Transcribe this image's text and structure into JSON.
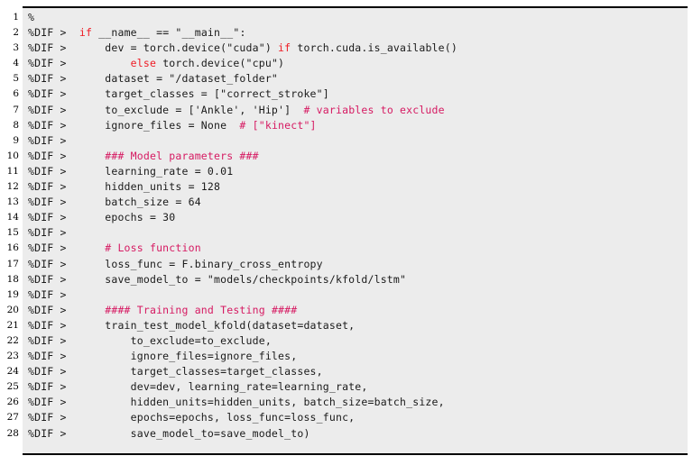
{
  "listing": {
    "kind": "latexdiff-code-listing",
    "background_color": "#ececec",
    "page_background": "#ffffff",
    "rule_color": "#000000",
    "text_color": "#1a1a1a",
    "keyword_color": "#ee1c25",
    "comment_color": "#d61a62",
    "line_number_color": "#000000",
    "first_line_number": 1,
    "last_line_number": 28,
    "total_lines": 28,
    "diff_marker": "%DIF >",
    "line_numbers": [
      "1",
      "2",
      "3",
      "4",
      "5",
      "6",
      "7",
      "8",
      "9",
      "10",
      "11",
      "12",
      "13",
      "14",
      "15",
      "16",
      "17",
      "18",
      "19",
      "20",
      "21",
      "22",
      "23",
      "24",
      "25",
      "26",
      "27",
      "28"
    ],
    "lines": [
      {
        "number": "1",
        "tokens": [
          {
            "t": "%",
            "c": "pln"
          }
        ]
      },
      {
        "number": "2",
        "tokens": [
          {
            "t": "%DIF >  ",
            "c": "pln"
          },
          {
            "t": "if",
            "c": "kw"
          },
          {
            "t": " __name__ == \"__main__\":",
            "c": "pln"
          }
        ]
      },
      {
        "number": "3",
        "tokens": [
          {
            "t": "%DIF >      dev = torch.device(\"cuda\") ",
            "c": "pln"
          },
          {
            "t": "if",
            "c": "kw"
          },
          {
            "t": " torch.cuda.is_available()",
            "c": "pln"
          }
        ]
      },
      {
        "number": "4",
        "tokens": [
          {
            "t": "%DIF >          ",
            "c": "pln"
          },
          {
            "t": "else",
            "c": "kw"
          },
          {
            "t": " torch.device(\"cpu\")",
            "c": "pln"
          }
        ]
      },
      {
        "number": "5",
        "tokens": [
          {
            "t": "%DIF >      dataset = \"/dataset_folder\"",
            "c": "pln"
          }
        ]
      },
      {
        "number": "6",
        "tokens": [
          {
            "t": "%DIF >      target_classes = [\"correct_stroke\"]",
            "c": "pln"
          }
        ]
      },
      {
        "number": "7",
        "tokens": [
          {
            "t": "%DIF >      to_exclude = ['Ankle', 'Hip']  ",
            "c": "pln"
          },
          {
            "t": "# variables to exclude",
            "c": "com"
          }
        ]
      },
      {
        "number": "8",
        "tokens": [
          {
            "t": "%DIF >      ignore_files = None  ",
            "c": "pln"
          },
          {
            "t": "# [\"kinect\"]",
            "c": "com"
          }
        ]
      },
      {
        "number": "9",
        "tokens": [
          {
            "t": "%DIF >",
            "c": "pln"
          }
        ]
      },
      {
        "number": "10",
        "tokens": [
          {
            "t": "%DIF >      ",
            "c": "pln"
          },
          {
            "t": "### Model parameters ###",
            "c": "com"
          }
        ]
      },
      {
        "number": "11",
        "tokens": [
          {
            "t": "%DIF >      learning_rate = 0.01",
            "c": "pln"
          }
        ]
      },
      {
        "number": "12",
        "tokens": [
          {
            "t": "%DIF >      hidden_units = 128",
            "c": "pln"
          }
        ]
      },
      {
        "number": "13",
        "tokens": [
          {
            "t": "%DIF >      batch_size = 64",
            "c": "pln"
          }
        ]
      },
      {
        "number": "14",
        "tokens": [
          {
            "t": "%DIF >      epochs = 30",
            "c": "pln"
          }
        ]
      },
      {
        "number": "15",
        "tokens": [
          {
            "t": "%DIF >",
            "c": "pln"
          }
        ]
      },
      {
        "number": "16",
        "tokens": [
          {
            "t": "%DIF >      ",
            "c": "pln"
          },
          {
            "t": "# Loss function",
            "c": "com"
          }
        ]
      },
      {
        "number": "17",
        "tokens": [
          {
            "t": "%DIF >      loss_func = F.binary_cross_entropy",
            "c": "pln"
          }
        ]
      },
      {
        "number": "18",
        "tokens": [
          {
            "t": "%DIF >      save_model_to = \"models/checkpoints/kfold/lstm\"",
            "c": "pln"
          }
        ]
      },
      {
        "number": "19",
        "tokens": [
          {
            "t": "%DIF >",
            "c": "pln"
          }
        ]
      },
      {
        "number": "20",
        "tokens": [
          {
            "t": "%DIF >      ",
            "c": "pln"
          },
          {
            "t": "#### Training and Testing ####",
            "c": "com"
          }
        ]
      },
      {
        "number": "21",
        "tokens": [
          {
            "t": "%DIF >      train_test_model_kfold(dataset=dataset,",
            "c": "pln"
          }
        ]
      },
      {
        "number": "22",
        "tokens": [
          {
            "t": "%DIF >          to_exclude=to_exclude,",
            "c": "pln"
          }
        ]
      },
      {
        "number": "23",
        "tokens": [
          {
            "t": "%DIF >          ignore_files=ignore_files,",
            "c": "pln"
          }
        ]
      },
      {
        "number": "24",
        "tokens": [
          {
            "t": "%DIF >          target_classes=target_classes,",
            "c": "pln"
          }
        ]
      },
      {
        "number": "25",
        "tokens": [
          {
            "t": "%DIF >          dev=dev, learning_rate=learning_rate,",
            "c": "pln"
          }
        ]
      },
      {
        "number": "26",
        "tokens": [
          {
            "t": "%DIF >          hidden_units=hidden_units, batch_size=batch_size,",
            "c": "pln"
          }
        ]
      },
      {
        "number": "27",
        "tokens": [
          {
            "t": "%DIF >          epochs=epochs, loss_func=loss_func,",
            "c": "pln"
          }
        ]
      },
      {
        "number": "28",
        "tokens": [
          {
            "t": "%DIF >          save_model_to=save_model_to)",
            "c": "pln"
          }
        ]
      }
    ]
  }
}
